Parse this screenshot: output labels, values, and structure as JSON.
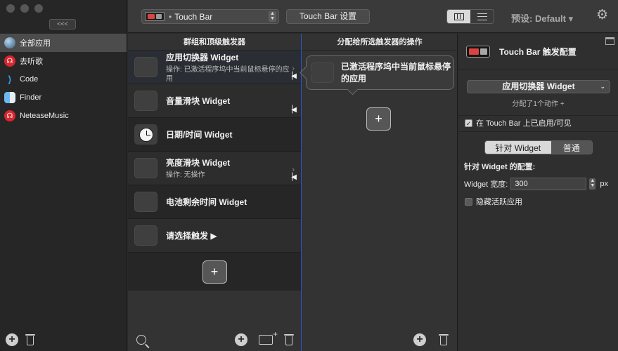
{
  "window": {
    "collapse_label": "<<<"
  },
  "sidebar": {
    "items": [
      {
        "label": "全部应用",
        "icon": "globe-icon",
        "selected": true
      },
      {
        "label": "去听歌",
        "icon": "netease-icon"
      },
      {
        "label": "Code",
        "icon": "vscode-icon"
      },
      {
        "label": "Finder",
        "icon": "finder-icon"
      },
      {
        "label": "NeteaseMusic",
        "icon": "netease-icon"
      }
    ]
  },
  "toolbar": {
    "touchbar_select": "Touch Bar",
    "settings_button": "Touch Bar 设置",
    "preset": "预设: Default ▾"
  },
  "triggers": {
    "header": "群组和顶级触发器",
    "items": [
      {
        "title": "应用切换器 Widget",
        "subtitle": "操作: 已激活程序坞中当前鼠标悬停的应用"
      },
      {
        "title": "音量滑块 Widget",
        "subtitle": ""
      },
      {
        "title": "日期/时间 Widget",
        "subtitle": ""
      },
      {
        "title": "亮度滑块 Widget",
        "subtitle": "操作: 无操作"
      },
      {
        "title": "电池剩余时间 Widget",
        "subtitle": ""
      },
      {
        "title": "请选择触发 ▶",
        "subtitle": ""
      }
    ],
    "add_label": "+"
  },
  "actions": {
    "header": "分配给所选触发器的操作",
    "card_text": "已激活程序坞中当前鼠标悬停的应用",
    "add_label": "+"
  },
  "inspector": {
    "title": "Touch Bar 触发配置",
    "widget_select": "应用切换器 Widget",
    "assigned": "分配了1个动作 +",
    "enabled_label": "在 Touch Bar 上已启用/可见",
    "mode_widget": "针对 Widget",
    "mode_normal": "普通",
    "config_label": "针对 Widget 的配置:",
    "width_label": "Widget 宽度:",
    "width_value": "300",
    "width_unit": "px",
    "hide_label": "隐藏活跃应用"
  },
  "colors": {
    "selection_border": "#2a5bd7",
    "netease_red": "#d8262f",
    "vscode_blue": "#2f9ae8"
  }
}
